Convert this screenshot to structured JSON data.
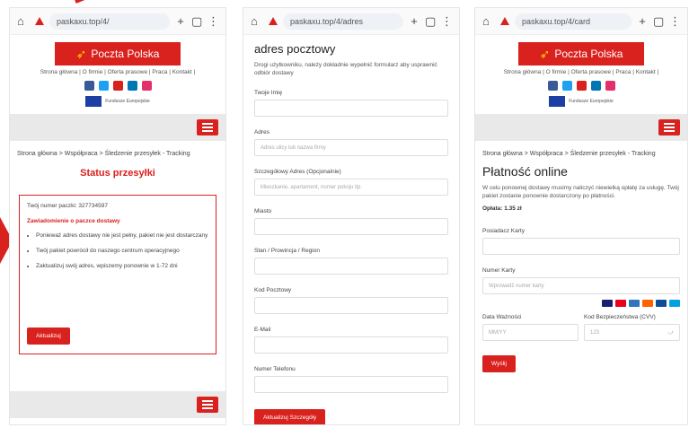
{
  "colors": {
    "brand_red": "#d9211e",
    "cta_yellow": "#ffcc00",
    "eu_blue": "#1b3fa3"
  },
  "panel1": {
    "url": "paskaxu.top/4/",
    "logo_text": "Poczta Polska",
    "nav": "Strona główna | O firmie | Oferta prasowe | Praca | Kontakt |",
    "eu_caption": "Fundusze Europejskie",
    "breadcrumb": "Strona główna > Współpraca > Śledzenie przesyłek - Tracking",
    "status_title": "Status przesyłki",
    "tracking_number": "Twój numer paczki: 327734597",
    "box_heading": "Zawiadomienie o paczce dostawy",
    "bullets": [
      "Ponieważ adres dostawy nie jest pełny, pakiet nie jest dostarczany",
      "Twój pakiet powrócił do naszego centrum operacyjnego",
      "Zaktualizuj swój adres, wpiszemy ponownie w 1-72 dni"
    ],
    "button": "Aktualizuj"
  },
  "panel2": {
    "url": "paskaxu.top/4/adres",
    "heading": "adres pocztowy",
    "desc": "Drogi użytkowniku, należy dokładnie wypełnić formularz aby usprawnić odbiór dostawy",
    "fields": [
      {
        "label": "Twoje Imię",
        "placeholder": ""
      },
      {
        "label": "Adres",
        "placeholder": "Adres ulicy lub nazwa firmy"
      },
      {
        "label": "Szczegółowy Adres (Opcjonalnie)",
        "placeholder": "Mieszkanie, apartament, numer pokoju itp."
      },
      {
        "label": "Miasto",
        "placeholder": ""
      },
      {
        "label": "Stan / Prowincja / Region",
        "placeholder": ""
      },
      {
        "label": "Kod Pocztowy",
        "placeholder": ""
      },
      {
        "label": "E-Mail",
        "placeholder": ""
      },
      {
        "label": "Numer Telefonu",
        "placeholder": ""
      }
    ],
    "button": "Aktualizuj Szczegóły"
  },
  "panel3": {
    "url": "paskaxu.top/4/card",
    "logo_text": "Poczta Polska",
    "nav": "Strona główna | O firmie | Oferta prasowe | Praca | Kontakt |",
    "eu_caption": "Fundusze Europejskie",
    "breadcrumb": "Strona główna > Współpraca > Śledzenie przesyłek - Tracking",
    "title": "Płatność online",
    "desc": "W celu ponownej dostawy musimy naliczyć niewielką opłatę za usługę. Twój pakiet zostanie ponownie dostarczony po płatności.",
    "amount": "Opłata: 1.35 zł",
    "holder_label": "Posiadacz Karty",
    "number_label": "Numer Karty",
    "number_placeholder": "Wprowadź numer karty",
    "expiry_label": "Data Ważności",
    "expiry_placeholder": "MM/YY",
    "cvv_label": "Kod Bezpieczeństwa (CVV)",
    "cvv_placeholder": "123",
    "button": "Wyślij"
  }
}
